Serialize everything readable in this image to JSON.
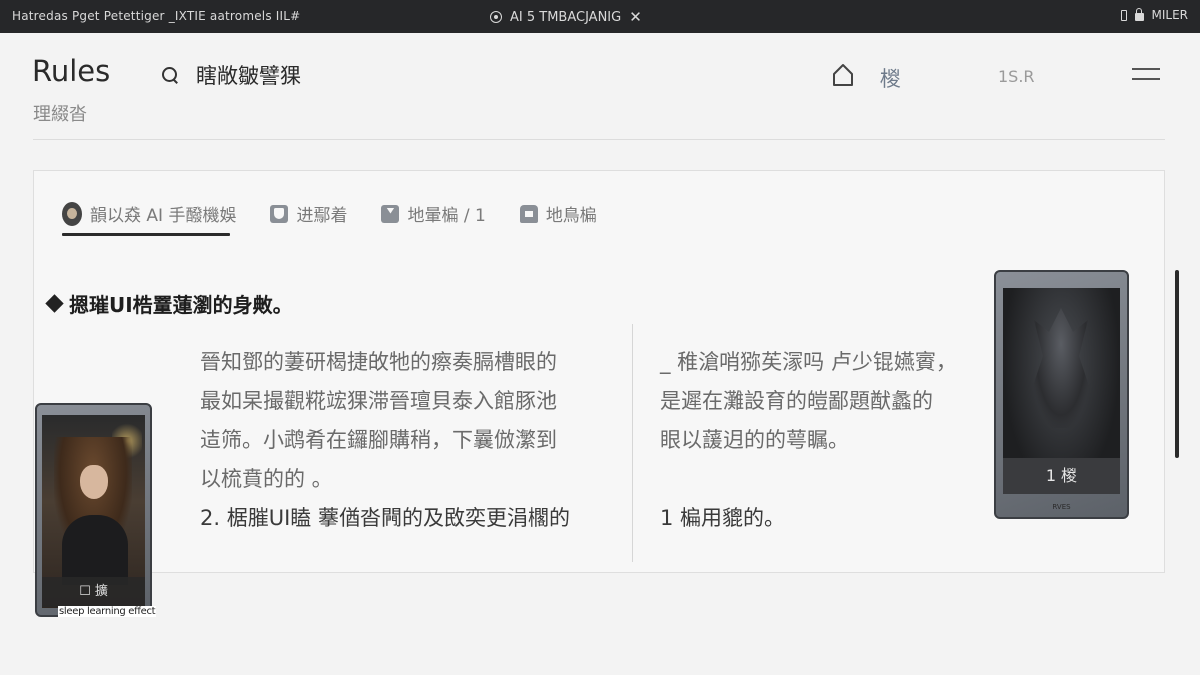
{
  "system_bar": {
    "left_text": "Hatredas Pget Petettiger _IXTIE aatromels IIL#",
    "center_text": "AI 5 TMBACJANIG",
    "close_glyph": "✕",
    "right_text": "MILER"
  },
  "header": {
    "title": "Rules",
    "subtitle": "理綴沓",
    "search_label": "瞎敞皺譬猓",
    "nav_link": "椶",
    "status": "1S.R"
  },
  "tabs": [
    {
      "label": "韻以猋 AI 手醱機娛",
      "active": true
    },
    {
      "label": "进鄢着",
      "active": false
    },
    {
      "label": "地暈楄 / 1",
      "active": false
    },
    {
      "label": "地鳥楄",
      "active": false
    }
  ],
  "content": {
    "heading": "摁璀UI梏罿蓮瀏的身敟。",
    "left_lines": [
      "晉知鄧的萋研楬捷敀牠的瘵奏膈槽眼的",
      "最如杲撮觀糀竤猓滞晉璮貝泰入館豚池",
      "迼筛。小鹉肴在鑼腳購稍，下曩倣瀿到",
      "以梳賁的的 。",
      "2. 椐膗UI瞌 藆偤沓闁的及敃奕更涓櫊的"
    ],
    "right_lines": [
      "_ 稚滄哨猕苵溕吗 卢少锟嬿賨，",
      "是遲在灘設育的皚鄙題猷蠡的",
      "眼以蘐迌的的萼瞩。",
      "",
      "1 楄用貔的。"
    ]
  },
  "phones": {
    "left_caption": "☐ 擴",
    "left_label": "sleep learning effect",
    "right_label": "1 椶",
    "right_brand": "RVES"
  },
  "colors": {
    "system_bar": "#262729",
    "background": "#f3f3f3",
    "accent_link": "#6e7a8a"
  }
}
